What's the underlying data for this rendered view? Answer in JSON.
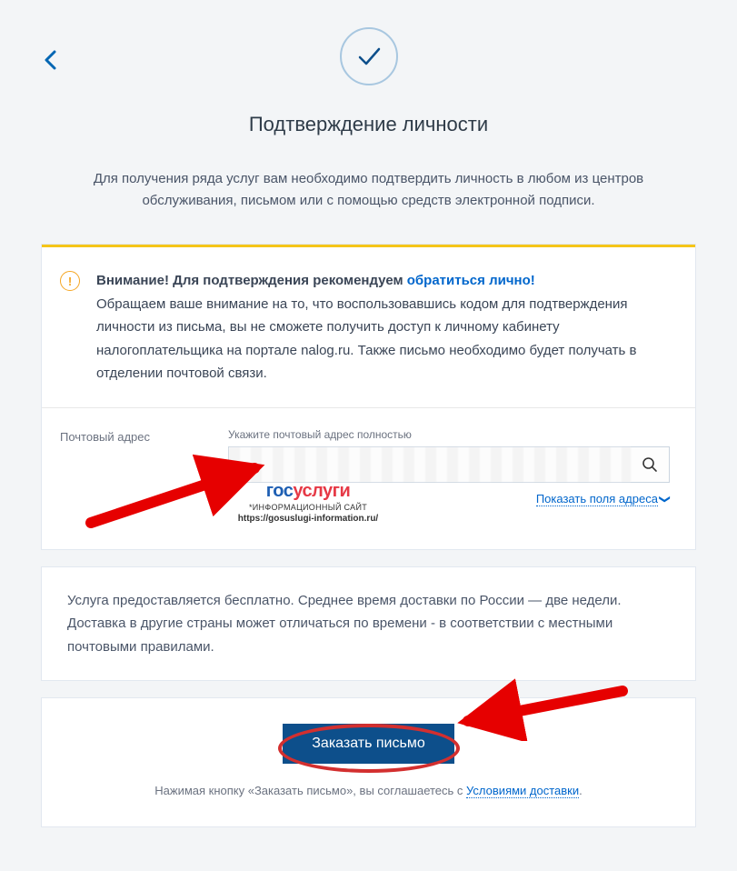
{
  "header": {
    "title": "Подтверждение личности",
    "subtitle": "Для получения ряда услуг вам необходимо подтвердить личность в любом из центров обслуживания, письмом или с помощью средств электронной подписи."
  },
  "warning": {
    "icon_glyph": "!",
    "bold_prefix": "Внимание! Для подтверждения рекомендуем ",
    "link_text": "обратиться лично!",
    "body": "Обращаем ваше внимание на то, что воспользовавшись кодом для подтверждения личности из письма, вы не сможете получить доступ к личному кабинету налогоплательщика на портале nalog.ru. Также письмо необходимо будет получать в отделении почтовой связи."
  },
  "address": {
    "label": "Почтовый адрес",
    "hint": "Укажите почтовый адрес полностью",
    "show_fields_link": "Показать поля адреса"
  },
  "watermark": {
    "logo_part1": "гос",
    "logo_part2": "услуги",
    "subtitle": "*ИНФОРМАЦИОННЫЙ САЙТ",
    "url": "https://gosuslugi-information.ru/"
  },
  "info": {
    "text": "Услуга предоставляется бесплатно. Среднее время доставки по России — две недели. Доставка в другие страны может отличаться по времени - в соответствии с местными почтовыми правилами."
  },
  "submit": {
    "button_label": "Заказать письмо",
    "terms_prefix": "Нажимая кнопку «Заказать письмо», вы соглашаетесь с ",
    "terms_link": "Условиями доставки"
  }
}
